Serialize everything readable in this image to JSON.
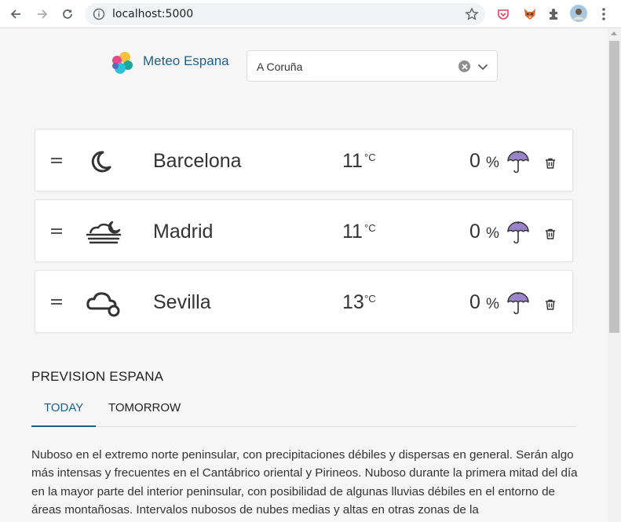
{
  "browser": {
    "url": "localhost:5000",
    "icons": [
      "back-arrow-icon",
      "forward-arrow-icon",
      "reload-icon",
      "info-icon",
      "star-icon",
      "extension-icons",
      "puzzle-icon",
      "profile-avatar",
      "more-vert-icon"
    ]
  },
  "app": {
    "title": "Meteo Espana",
    "selected_city": "A Coruña",
    "colors": {
      "accent": "#1f5f8b",
      "umbrella": "#9b84c9"
    }
  },
  "cities": [
    {
      "name": "Barcelona",
      "temp": "11",
      "unit": "°C",
      "rain": "0",
      "rain_unit": "%",
      "icon": "clear-night-moon-icon"
    },
    {
      "name": "Madrid",
      "temp": "11",
      "unit": "°C",
      "rain": "0",
      "rain_unit": "%",
      "icon": "fog-night-icon"
    },
    {
      "name": "Sevilla",
      "temp": "13",
      "unit": "°C",
      "rain": "0",
      "rain_unit": "%",
      "icon": "cloudy-night-icon"
    }
  ],
  "forecast": {
    "title": "PREVISION ESPANA",
    "tabs": [
      {
        "label": "TODAY",
        "active": true
      },
      {
        "label": "TOMORROW",
        "active": false
      }
    ],
    "text": "Nuboso en el extremo norte peninsular, con precipitaciones débiles y dispersas en general. Serán algo más intensas y frecuentes en el Cantábrico oriental y Pirineos. Nuboso durante la primera mitad del día en la mayor parte del interior peninsular, con posibilidad de algunas lluvias débiles en el entorno de áreas montañosas. Intervalos nubosos de nubes medias y altas en otras zonas de la"
  }
}
